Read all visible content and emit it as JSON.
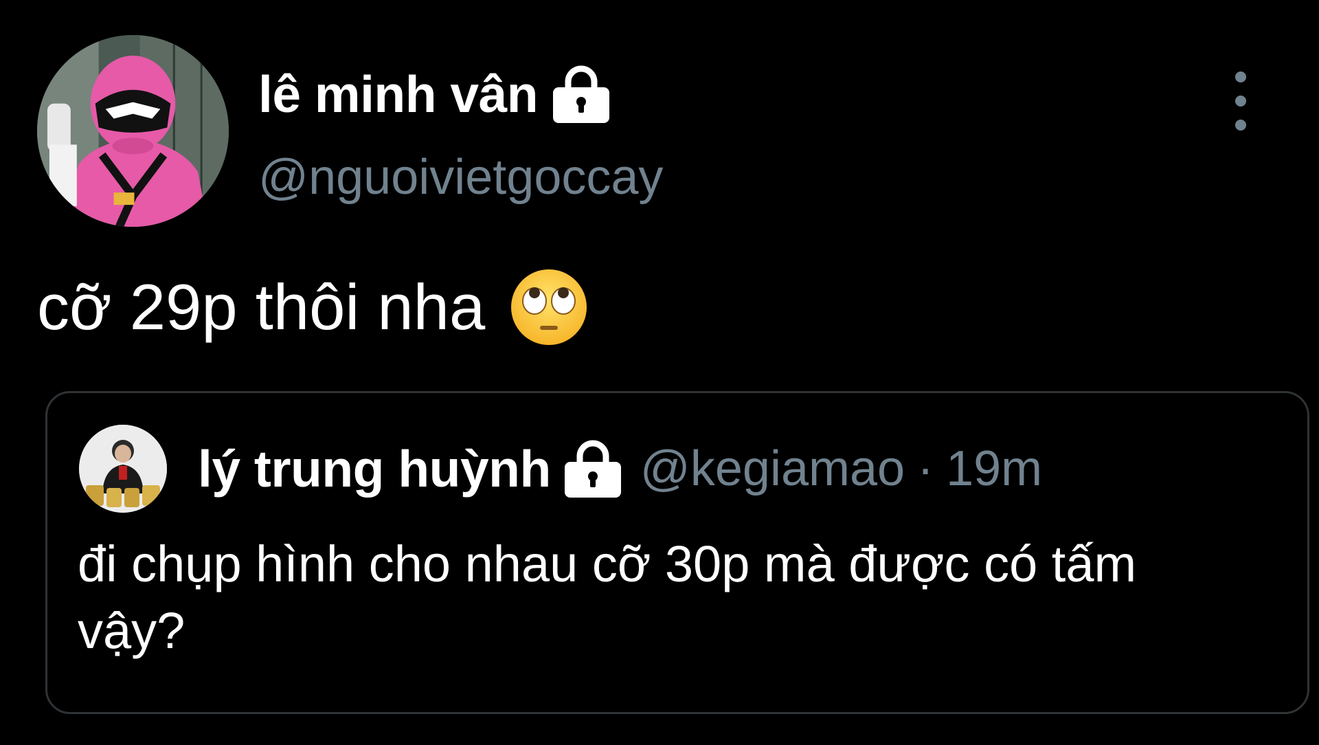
{
  "tweet": {
    "author": {
      "display_name": "lê minh vân",
      "handle": "@nguoivietgoccay",
      "avatar_icon": "pink-ranger-avatar",
      "protected_icon": "lock-icon"
    },
    "text": "cỡ 29p thôi nha",
    "emoji": "face-with-rolling-eyes",
    "more_icon": "more-vertical-icon"
  },
  "quoted_tweet": {
    "author": {
      "display_name": "lý trung huỳnh",
      "handle": "@kegiamao",
      "avatar_icon": "person-with-trophies-avatar",
      "protected_icon": "lock-icon"
    },
    "separator": "·",
    "time": "19m",
    "text": "đi chụp hình cho nhau cỡ 30p mà được có tấm vậy?"
  },
  "colors": {
    "background": "#000000",
    "primary_text": "#ffffff",
    "secondary_text": "#71828f",
    "border": "#2f3336"
  }
}
